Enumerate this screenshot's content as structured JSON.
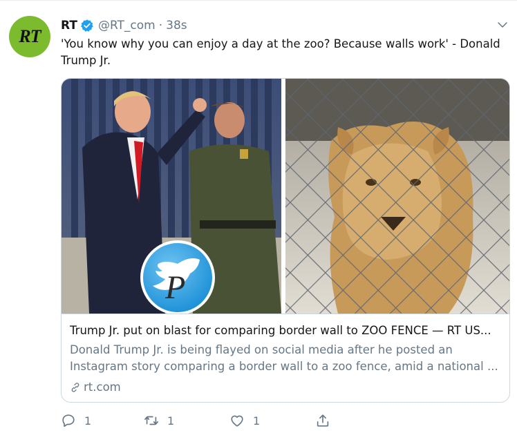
{
  "colors": {
    "avatar_bg": "#7dbb2e",
    "verified_blue": "#1da1f2",
    "text_primary": "#14171a",
    "text_secondary": "#657786",
    "border": "#ccd6dd"
  },
  "tweet": {
    "avatar_label": "RT",
    "author_name": "RT",
    "handle": "@RT_com",
    "separator": "·",
    "time": "38s",
    "text": "'You know why you can enjoy a day at the zoo? Because walls work' - Donald Trump Jr."
  },
  "card": {
    "title": "Trump Jr. put on blast for comparing border wall to ZOO FENCE — RT US...",
    "description": "Donald Trump Jr. is being flayed on social media after he posted an Instagram story comparing a border wall to a zoo fence, amid a national ...",
    "domain": "rt.com"
  },
  "actions": {
    "reply_count": "1",
    "retweet_count": "1",
    "like_count": "1"
  },
  "icons": [
    "verified-badge-icon",
    "chevron-down-icon",
    "link-icon",
    "reply-icon",
    "retweet-icon",
    "like-icon",
    "share-icon",
    "watermark-logo-icon"
  ]
}
